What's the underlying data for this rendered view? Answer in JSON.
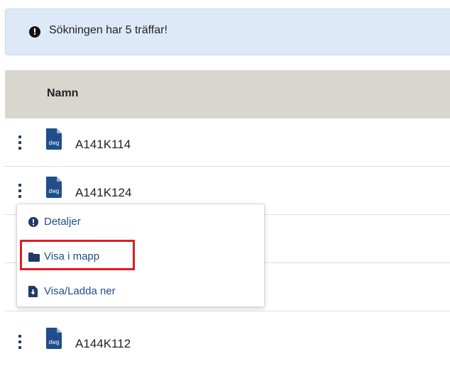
{
  "alert": {
    "text": "Sökningen har 5 träffar!",
    "icon": "exclamation-circle-icon"
  },
  "table": {
    "header": {
      "name": "Namn"
    },
    "rows": [
      {
        "name": "A141K114",
        "icon": "dwg-file-icon",
        "icon_label": "dwg"
      },
      {
        "name": "A141K124",
        "icon": "dwg-file-icon",
        "icon_label": "dwg"
      },
      {
        "name": "A144K112",
        "icon": "dwg-file-icon",
        "icon_label": "dwg"
      }
    ]
  },
  "context_menu": {
    "items": [
      {
        "label": "Detaljer",
        "icon": "info-circle-icon"
      },
      {
        "label": "Visa i mapp",
        "icon": "folder-icon"
      },
      {
        "label": "Visa/Ladda ner",
        "icon": "download-file-icon"
      }
    ]
  },
  "colors": {
    "alert_bg": "#dde9f8",
    "header_bg": "#d9d6d0",
    "link": "#1f4e8a",
    "highlight": "#e21b23"
  }
}
